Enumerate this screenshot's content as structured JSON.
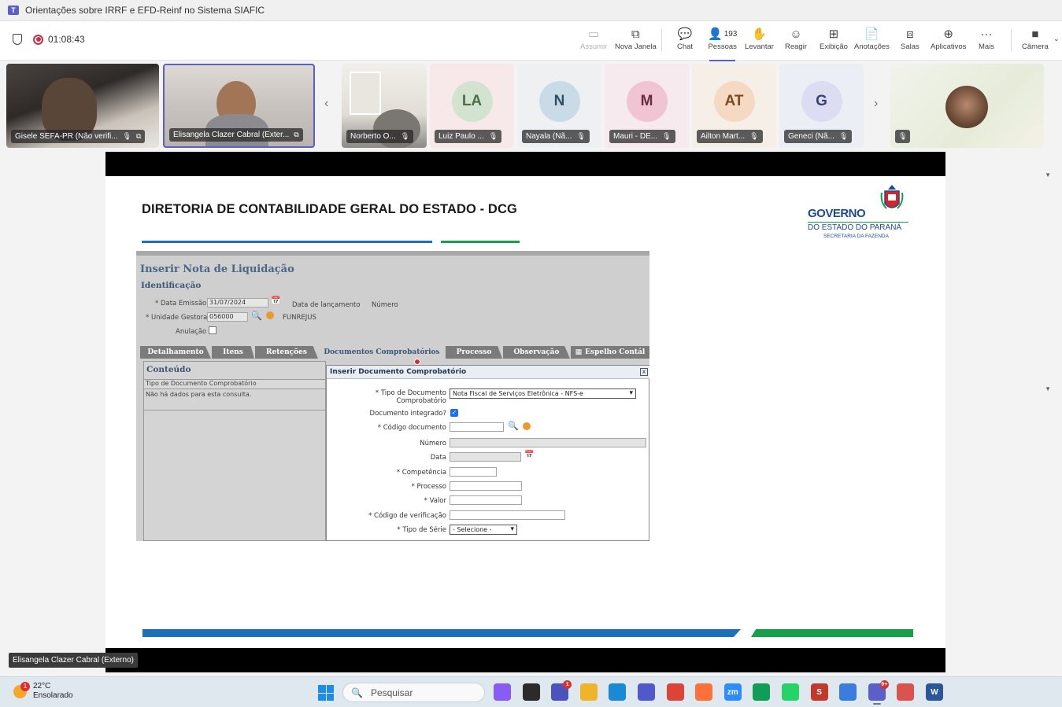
{
  "window": {
    "title": "Orientações sobre IRRF e EFD-Reinf no Sistema SIAFIC"
  },
  "meeting": {
    "timer": "01:08:43",
    "toolbar": [
      {
        "id": "assumir",
        "label": "Assumir",
        "icon": "screen-share-icon",
        "disabled": true
      },
      {
        "id": "nova-janela",
        "label": "Nova Janela",
        "icon": "pop-out-icon"
      },
      {
        "id": "chat",
        "label": "Chat",
        "icon": "chat-icon"
      },
      {
        "id": "pessoas",
        "label": "Pessoas",
        "icon": "people-icon",
        "count": "193",
        "active": true
      },
      {
        "id": "levantar",
        "label": "Levantar",
        "icon": "raise-hand-icon"
      },
      {
        "id": "reagir",
        "label": "Reagir",
        "icon": "smiley-icon"
      },
      {
        "id": "exibicao",
        "label": "Exibição",
        "icon": "grid-view-icon"
      },
      {
        "id": "anotacoes",
        "label": "Anotações",
        "icon": "notes-icon"
      },
      {
        "id": "salas",
        "label": "Salas",
        "icon": "rooms-icon"
      },
      {
        "id": "aplicativos",
        "label": "Aplicativos",
        "icon": "add-app-icon"
      },
      {
        "id": "mais",
        "label": "Mais",
        "icon": "more-icon"
      },
      {
        "id": "camera",
        "label": "Câmera",
        "icon": "camera-off-icon"
      }
    ]
  },
  "participants": [
    {
      "name": "Gisele SEFA-PR (Não verifi...",
      "type": "video"
    },
    {
      "name": "Elisangela Clazer Cabral (Exter...",
      "type": "video"
    },
    {
      "name": "Norberto O...",
      "type": "video"
    },
    {
      "name": "Luiz Paulo ...",
      "initials": "LA",
      "type": "avatar",
      "bg": "#f7e9ea",
      "circle": "#d2e3cf",
      "fg": "#4f6b47"
    },
    {
      "name": "Nayala (Nã...",
      "initials": "N",
      "type": "avatar",
      "bg": "#eef0f2",
      "circle": "#c8dbe6",
      "fg": "#2f4d63"
    },
    {
      "name": "Mauri - DE...",
      "initials": "M",
      "type": "avatar",
      "bg": "#f6eaee",
      "circle": "#f0c4d2",
      "fg": "#6a2c41"
    },
    {
      "name": "Ailton Mart...",
      "initials": "AT",
      "type": "avatar",
      "bg": "#f5efe8",
      "circle": "#f6d9c2",
      "fg": "#7a4a25"
    },
    {
      "name": "Geneci (Nã...",
      "initials": "G",
      "type": "avatar",
      "bg": "#eceef6",
      "circle": "#dcdcf2",
      "fg": "#3b3f7a"
    }
  ],
  "slide": {
    "title": "DIRETORIA DE CONTABILIDADE GERAL DO ESTADO - DCG",
    "logo": {
      "line1": "GOVERNO",
      "line2": "DO ESTADO DO PARANÁ",
      "line3": "SECRETARIA DA FAZENDA"
    }
  },
  "app": {
    "heading": "Inserir Nota de Liquidação",
    "section": "Identificação",
    "fields": {
      "data_emissao_label": "* Data Emissão",
      "data_emissao_value": "31/07/2024",
      "data_lancamento_label": "Data de lançamento",
      "numero_label": "Número",
      "unidade_label": "* Unidade Gestora",
      "unidade_value": "056000",
      "unidade_nome": "FUNREJUS",
      "anulacao_label": "Anulação"
    },
    "tabs": [
      "Detalhamento",
      "Itens",
      "Retenções",
      "Documentos Comprobatórios",
      "Processo",
      "Observação",
      "Espelho Contál"
    ],
    "content": {
      "title": "Conteúdo",
      "column": "Tipo de Documento Comprobatório",
      "empty": "Não há dados para esta consulta."
    },
    "dialog": {
      "title": "Inserir Documento Comprobatório",
      "close": "x",
      "tipo_label_1": "* Tipo de Documento",
      "tipo_label_2": "Comprobatório",
      "tipo_value": "Nota Fiscal de Serviços Eletrônica - NFS-e",
      "integrado_label": "Documento integrado?",
      "codigo_label": "* Código documento",
      "numero_label": "Número",
      "data_label": "Data",
      "competencia_label": "* Competência",
      "processo_label": "* Processo",
      "valor_label": "* Valor",
      "verificacao_label": "* Código de verificação",
      "serie_label": "* Tipo de Série",
      "serie_value": "- Selecione -"
    }
  },
  "speaker_label": "Elisangela Clazer Cabral (Externo)",
  "taskbar": {
    "weather_badge": "1",
    "temperature": "22°C",
    "condition": "Ensolarado",
    "search_placeholder": "Pesquisar",
    "apps": [
      {
        "name": "copilot-icon",
        "color": "#8a5cf6",
        "label": ""
      },
      {
        "name": "taskview-icon",
        "color": "#2b2b2b",
        "label": ""
      },
      {
        "name": "teams-chat-icon",
        "color": "#4b53bc",
        "label": "",
        "badge": "1"
      },
      {
        "name": "file-explorer-icon",
        "color": "#f0b429",
        "label": ""
      },
      {
        "name": "edge-icon",
        "color": "#1a8ad6",
        "label": ""
      },
      {
        "name": "teams-icon",
        "color": "#5059c9",
        "label": ""
      },
      {
        "name": "chrome-icon",
        "color": "#db4437",
        "label": ""
      },
      {
        "name": "firefox-icon",
        "color": "#ff7139",
        "label": ""
      },
      {
        "name": "zoom-icon",
        "color": "#2d8cff",
        "label": "zm"
      },
      {
        "name": "meet-icon",
        "color": "#0f9d58",
        "label": ""
      },
      {
        "name": "whatsapp-icon",
        "color": "#25d366",
        "label": ""
      },
      {
        "name": "s-app-icon",
        "color": "#c0392b",
        "label": "S"
      },
      {
        "name": "notepad-icon",
        "color": "#3b7ddd",
        "label": ""
      },
      {
        "name": "teams-active-icon",
        "color": "#5b5fc7",
        "label": "",
        "badge": "9+",
        "active": true
      },
      {
        "name": "snipping-icon",
        "color": "#d9534f",
        "label": ""
      },
      {
        "name": "word-icon",
        "color": "#2b579a",
        "label": "W"
      }
    ]
  }
}
